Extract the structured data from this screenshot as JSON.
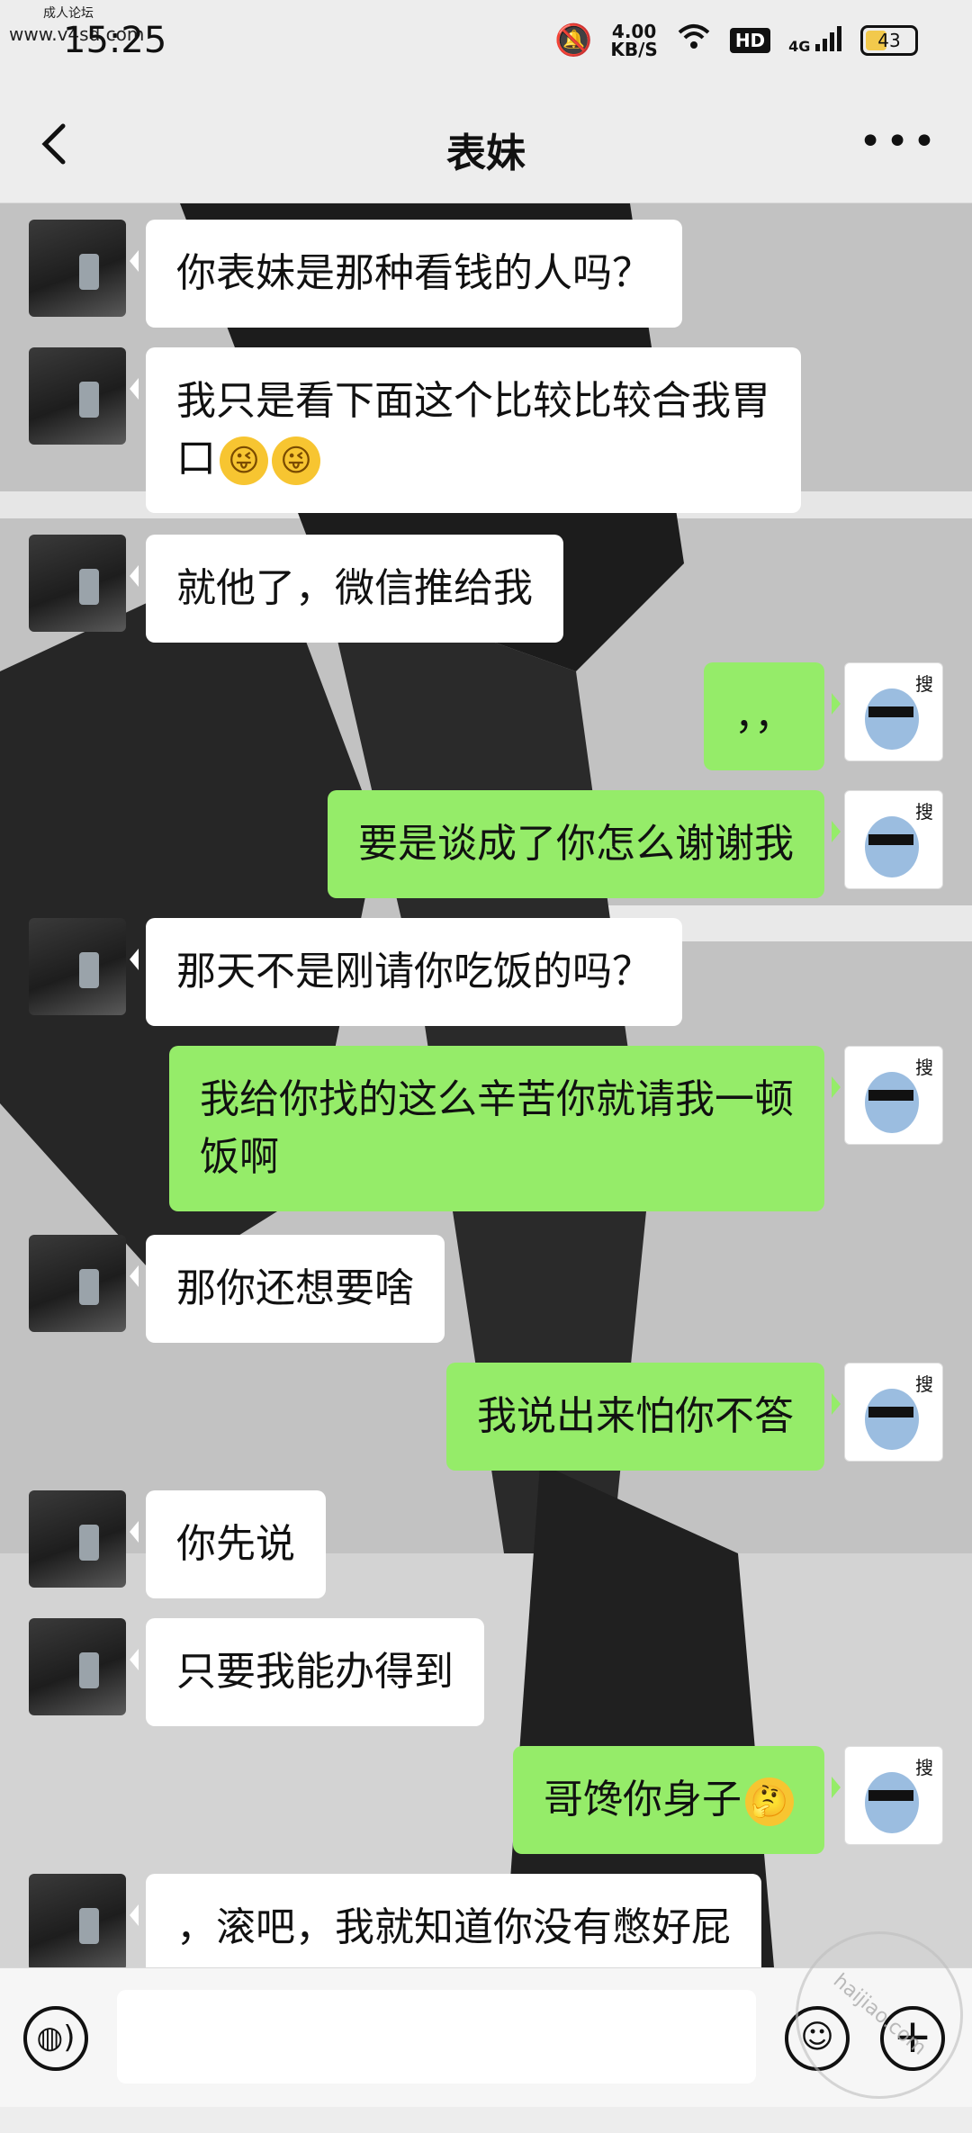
{
  "status_bar": {
    "watermark_line1": "成人论坛",
    "watermark_line2": "www.v4sd.com",
    "time": "15:25",
    "net_speed_value": "4.00",
    "net_speed_unit": "KB/S",
    "hd_label": "HD",
    "network_label": "4G",
    "battery": "43"
  },
  "header": {
    "title": "表妹"
  },
  "messages": [
    {
      "side": "left",
      "text": "你表妹是那种看钱的人吗？"
    },
    {
      "side": "left",
      "text": "我只是看下面这个比较比较合我胃",
      "text2": "口"
    },
    {
      "side": "left",
      "text": "就他了，微信推给我"
    },
    {
      "side": "right",
      "text": "，，"
    },
    {
      "side": "right",
      "text": "要是谈成了你怎么谢谢我"
    },
    {
      "side": "left",
      "text": "那天不是刚请你吃饭的吗？"
    },
    {
      "side": "right",
      "text": "我给你找的这么辛苦你就请我一顿",
      "text2": "饭啊"
    },
    {
      "side": "left",
      "text": "那你还想要啥"
    },
    {
      "side": "right",
      "text": "我说出来怕你不答"
    },
    {
      "side": "left",
      "text": "你先说"
    },
    {
      "side": "left",
      "text": "只要我能办得到"
    },
    {
      "side": "right",
      "text": "哥馋你身子"
    },
    {
      "side": "left",
      "text": "，滚吧，我就知道你没有憋好屁"
    }
  ],
  "sticker_char": "搜",
  "watermark_bottom": "haijiao.com",
  "colors": {
    "bg": "#ededed",
    "my_bubble": "#95ec69",
    "her_bubble": "#ffffff"
  }
}
